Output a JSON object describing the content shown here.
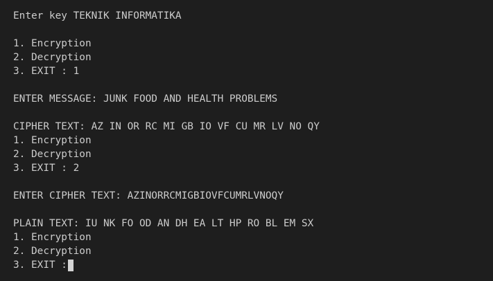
{
  "terminal": {
    "line_key": "Enter key TEKNIK INFORMATIKA",
    "menu1": {
      "opt1": "1. Encryption",
      "opt2": "2. Decryption",
      "opt3": "3. EXIT : 1"
    },
    "line_message": "ENTER MESSAGE: JUNK FOOD AND HEALTH PROBLEMS",
    "line_cipher": "CIPHER TEXT: AZ IN OR RC MI GB IO VF CU MR LV NO QY",
    "menu2": {
      "opt1": "1. Encryption",
      "opt2": "2. Decryption",
      "opt3": "3. EXIT : 2"
    },
    "line_cipher_input": "ENTER CIPHER TEXT: AZINORRCMIGBIOVFCUMRLVNOQY",
    "line_plain": "PLAIN TEXT: IU NK FO OD AN DH EA LT HP RO BL EM SX",
    "menu3": {
      "opt1": "1. Encryption",
      "opt2": "2. Decryption",
      "opt3": "3. EXIT :"
    }
  },
  "colors": {
    "background": "#1e1e1e",
    "text": "#cccccc",
    "cursor": "#d4d4d4"
  }
}
